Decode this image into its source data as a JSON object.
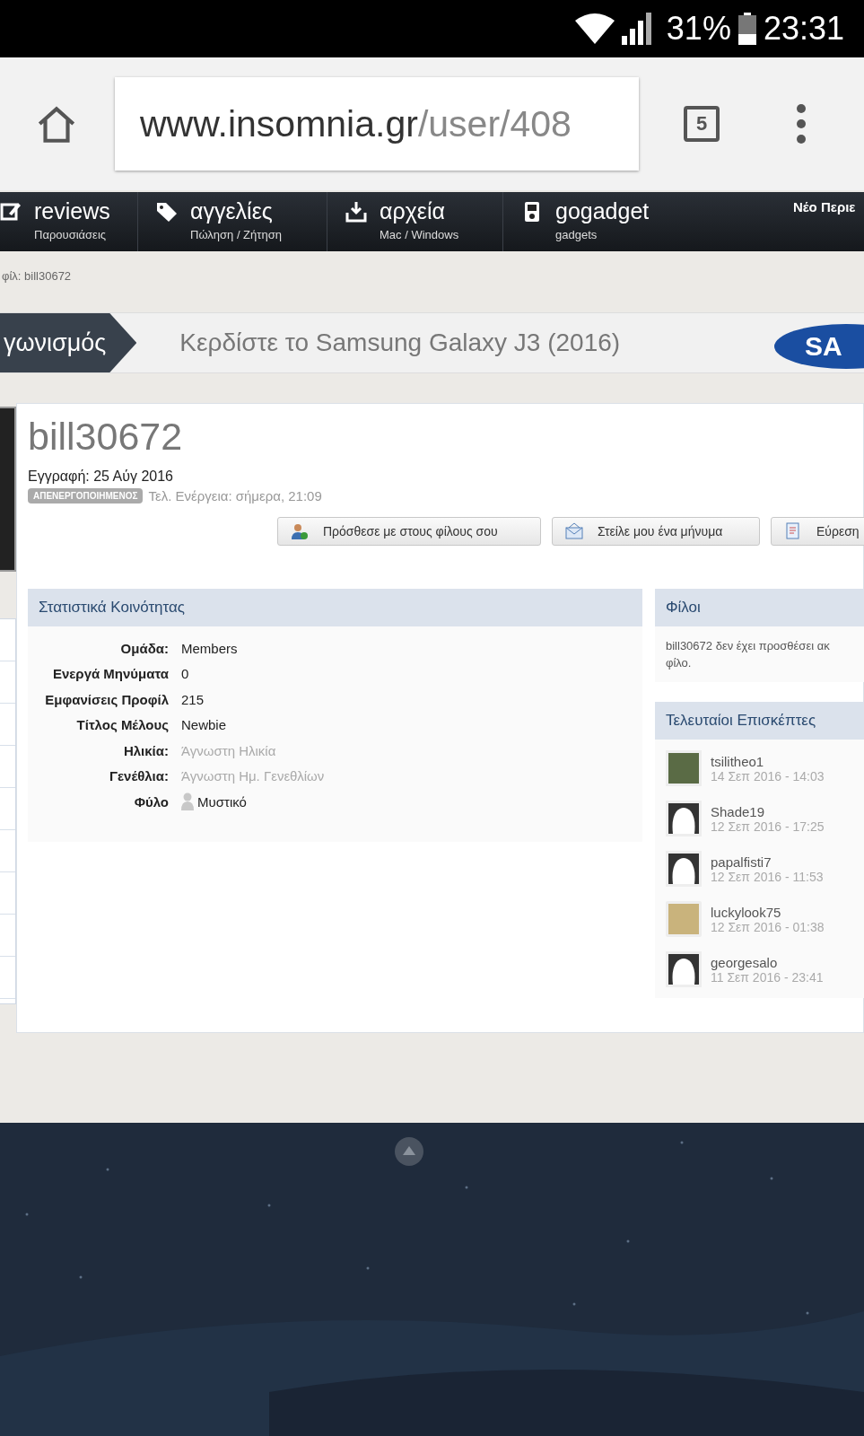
{
  "status_bar": {
    "battery": "31%",
    "time": "23:31"
  },
  "browser": {
    "url_host": "www.insomnia.gr",
    "url_path": "/user/408",
    "tab_count": "5"
  },
  "nav": {
    "items": [
      {
        "kind": "edit",
        "label": "reviews",
        "sub": "Παρουσιάσεις"
      },
      {
        "kind": "tag",
        "label": "αγγελίες",
        "sub": "Πώληση / Ζήτηση"
      },
      {
        "kind": "download",
        "label": "αρχεία",
        "sub": "Mac / Windows"
      },
      {
        "kind": "player",
        "label": "gogadget",
        "sub": "gadgets"
      }
    ],
    "right_link": "Νέο Περιε"
  },
  "breadcrumb": "φίλ: bill30672",
  "banner": {
    "tag": "γωνισμός",
    "text": "Κερδίστε το Samsung Galaxy J3 (2016)",
    "logo_text": "SA"
  },
  "profile": {
    "username": "bill30672",
    "joined": "Εγγραφή: 25 Αύγ 2016",
    "badge": "ΑΠΕΝΕΡΓΟΠΟΙΗΜΕΝΟΣ",
    "last_activity": "Τελ. Ενέργεια: σήμερα, 21:09",
    "buttons": [
      {
        "kind": "add-friend",
        "label": "Πρόσθεσε με στους φίλους σου"
      },
      {
        "kind": "message",
        "label": "Στείλε μου ένα μήνυμα"
      },
      {
        "kind": "find",
        "label": "Εύρεση"
      }
    ]
  },
  "stats": {
    "title": "Στατιστικά Κοινότητας",
    "rows": [
      {
        "label": "Ομάδα:",
        "value": "Members",
        "muted": false
      },
      {
        "label": "Ενεργά Μηνύματα",
        "value": "0",
        "muted": false
      },
      {
        "label": "Εμφανίσεις Προφίλ",
        "value": "215",
        "muted": false
      },
      {
        "label": "Τίτλος Μέλους",
        "value": "Newbie",
        "muted": false
      },
      {
        "label": "Ηλικία:",
        "value": "Άγνωστη Ηλικία",
        "muted": true
      },
      {
        "label": "Γενέθλια:",
        "value": "Άγνωστη Ημ. Γενεθλίων",
        "muted": true
      },
      {
        "label": "Φύλο",
        "value": "Μυστικό",
        "muted": false,
        "kind": "gender"
      }
    ]
  },
  "friends": {
    "title": "Φίλοι",
    "text": "bill30672 δεν έχει προσθέσει ακ φίλο."
  },
  "visitors": {
    "title": "Τελευταίοι Επισκέπτες",
    "items": [
      {
        "name": "tsilitheo1",
        "time": "14 Σεπ 2016 - 14:03",
        "kind": "photo"
      },
      {
        "name": "Shade19",
        "time": "12 Σεπ 2016 - 17:25",
        "kind": "default"
      },
      {
        "name": "papalfisti7",
        "time": "12 Σεπ 2016 - 11:53",
        "kind": "default"
      },
      {
        "name": "luckylook75",
        "time": "12 Σεπ 2016 - 01:38",
        "kind": "cartoon"
      },
      {
        "name": "georgesalo",
        "time": "11 Σεπ 2016 - 23:41",
        "kind": "default"
      }
    ]
  }
}
